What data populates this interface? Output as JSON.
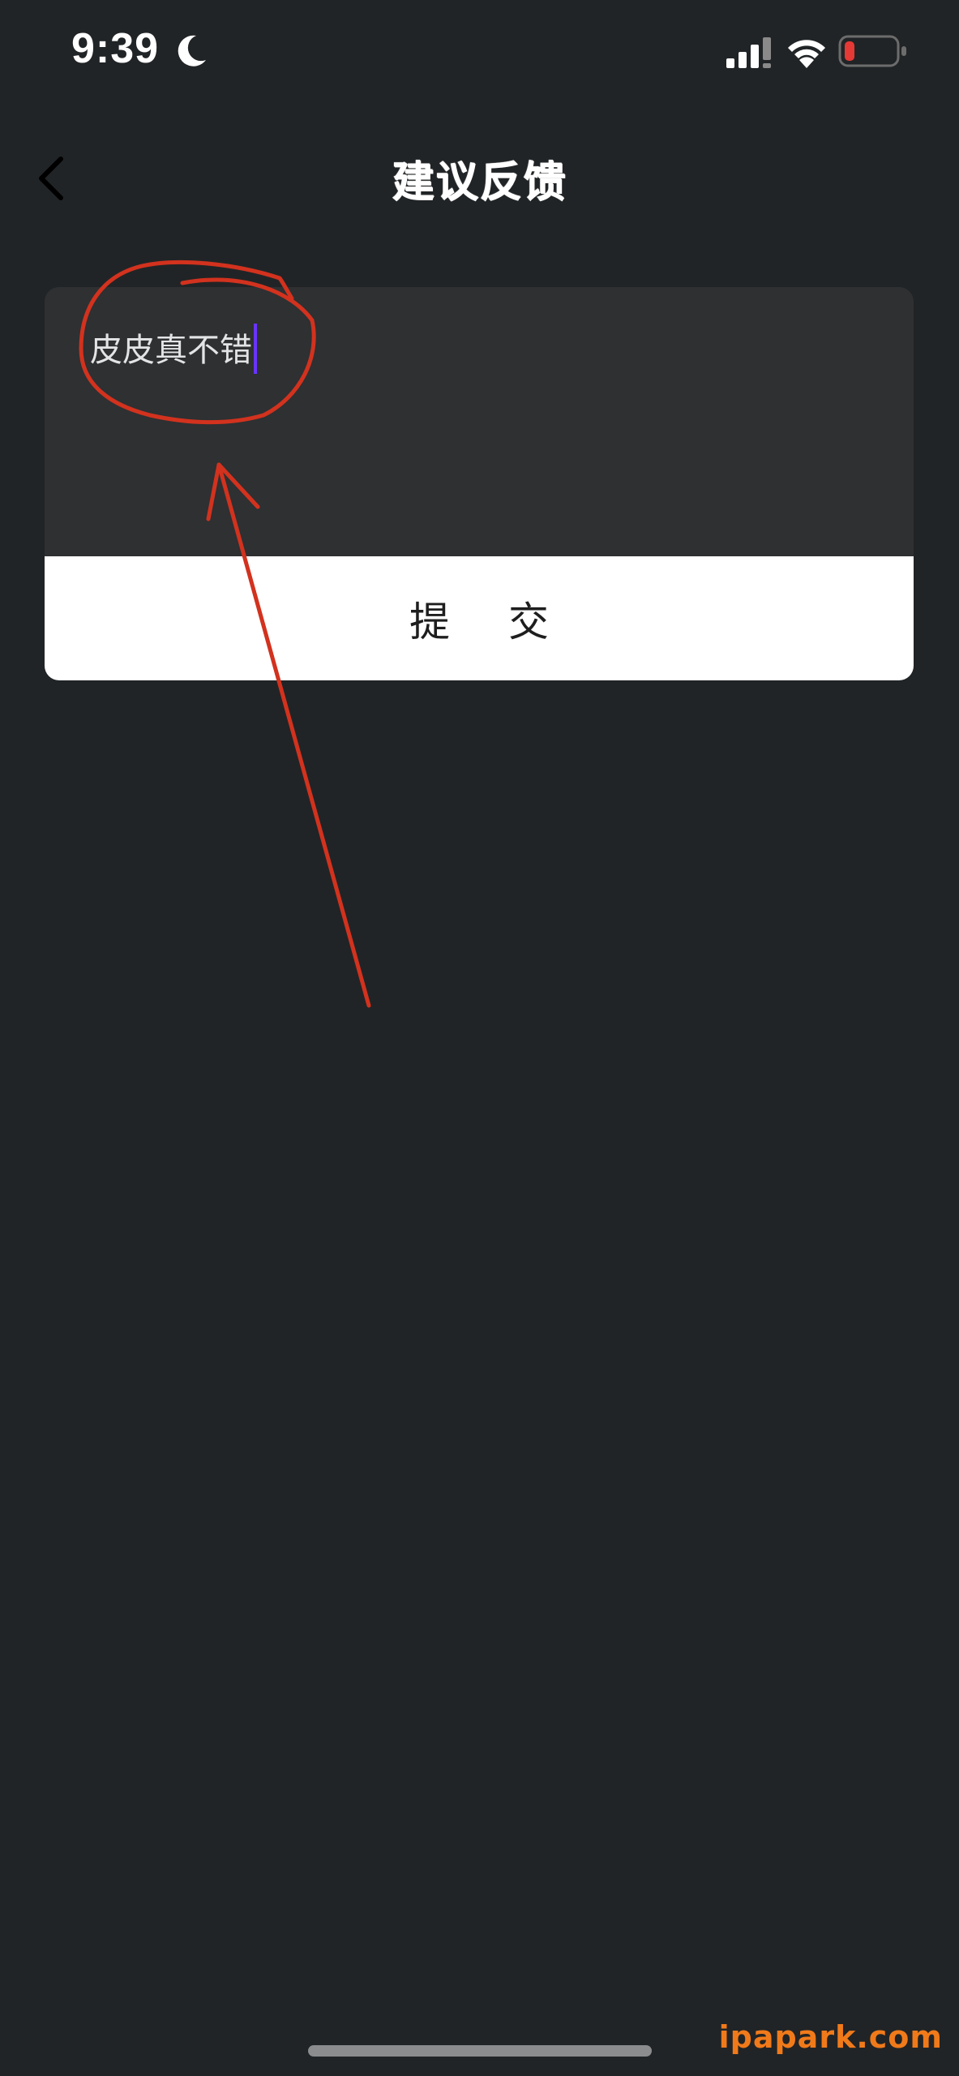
{
  "status_bar": {
    "time": "9:39",
    "moon_icon": "moon-icon",
    "signal_icon": "cellular-signal-icon",
    "wifi_icon": "wifi-icon",
    "battery_icon": "battery-low-icon",
    "battery_color": "#e53935"
  },
  "nav": {
    "back_icon": "chevron-left-icon",
    "title": "建议反馈"
  },
  "feedback": {
    "input_value": "皮皮真不错",
    "caret_color": "#6a34ff",
    "submit_label": "提 交"
  },
  "annotation": {
    "color": "#d2321e"
  },
  "watermark": "ipapark.com"
}
